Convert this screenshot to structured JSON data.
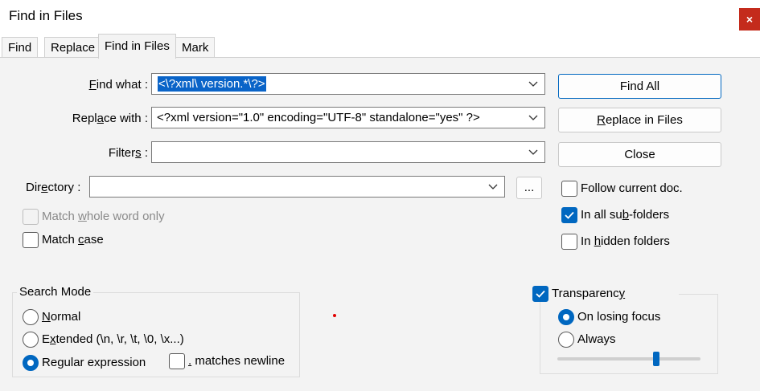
{
  "window": {
    "title": "Find in Files",
    "close_glyph": "×"
  },
  "tabs": [
    {
      "label": "Find"
    },
    {
      "label": "Replace"
    },
    {
      "label": "Find in Files",
      "active": true
    },
    {
      "label": "Mark"
    }
  ],
  "fields": {
    "find_what": {
      "label_pre": "",
      "label_u": "F",
      "label_post": "ind what :",
      "value": "<\\?xml\\ version.*\\?>"
    },
    "replace_with": {
      "label_pre": "Repl",
      "label_u": "a",
      "label_post": "ce with :",
      "value": "<?xml version=\"1.0\" encoding=\"UTF-8\" standalone=\"yes\" ?>"
    },
    "filters": {
      "label_pre": "Filter",
      "label_u": "s",
      "label_post": " :",
      "value": ""
    },
    "directory": {
      "label_pre": "Dir",
      "label_u": "e",
      "label_post": "ctory :",
      "value": "",
      "browse_label": "..."
    }
  },
  "buttons": {
    "find_all": "Find All",
    "replace_in_files_u": "R",
    "replace_in_files_rest": "eplace in Files",
    "close": "Close"
  },
  "options": {
    "match_whole_word": {
      "pre": "Match ",
      "u": "w",
      "post": "hole word only",
      "checked": false,
      "disabled": true
    },
    "match_case": {
      "pre": "Match ",
      "u": "c",
      "post": "ase",
      "checked": false
    },
    "follow_current_doc": {
      "label": "Follow current doc.",
      "checked": false
    },
    "in_all_subfolders": {
      "pre": "In all su",
      "u": "b",
      "post": "-folders",
      "checked": true
    },
    "in_hidden_folders": {
      "pre": "In ",
      "u": "h",
      "post": "idden folders",
      "checked": false
    }
  },
  "search_mode": {
    "title": "Search Mode",
    "normal": {
      "pre": "",
      "u": "N",
      "post": "ormal",
      "selected": false
    },
    "extended": {
      "pre": "E",
      "u": "x",
      "post": "tended (\\n, \\r, \\t, \\0, \\x...)",
      "selected": false
    },
    "regex": {
      "pre": "Re",
      "u": "g",
      "post": "ular expression",
      "selected": true
    },
    "matches_newline": {
      "u": ".",
      "post": " matches newline",
      "checked": false
    }
  },
  "transparency": {
    "pre": "Transparenc",
    "u": "y",
    "post": "",
    "enabled": true,
    "on_losing_focus": {
      "label": "On losing focus",
      "selected": true
    },
    "always": {
      "label": "Always",
      "selected": false
    },
    "slider_level": 0.7
  },
  "colors": {
    "accent": "#0067c0",
    "close_red": "#c42b1c",
    "selection": "#0a64c8"
  }
}
